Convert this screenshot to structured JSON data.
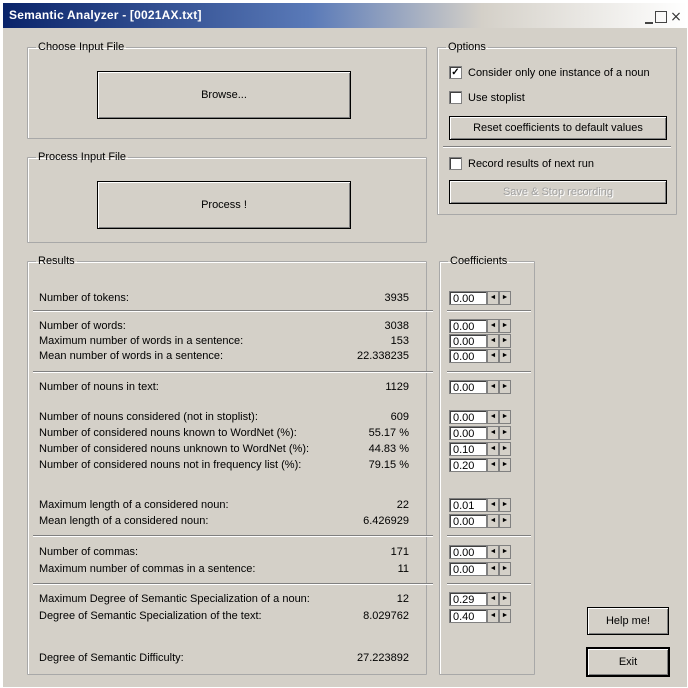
{
  "window": {
    "title": "Semantic Analyzer - [0021AX.txt]",
    "min_glyph": "",
    "max_glyph": "",
    "close_glyph": "×"
  },
  "choose": {
    "legend": "Choose Input File",
    "browse_label": "Browse..."
  },
  "process": {
    "legend": "Process Input File",
    "process_label": "Process !"
  },
  "options": {
    "legend": "Options",
    "one_instance": {
      "label": "Consider only one instance of a noun",
      "checked_glyph": "✓"
    },
    "stoplist": {
      "label": "Use stoplist",
      "checked_glyph": ""
    },
    "reset_label": "Reset coefficients to default values",
    "record": {
      "label": "Record results of next run",
      "checked_glyph": ""
    },
    "save_label": "Save & Stop recording"
  },
  "results": {
    "legend": "Results",
    "rows": [
      {
        "label": "Number of tokens:",
        "value": "3935"
      },
      {
        "label": "Number of words:",
        "value": "3038"
      },
      {
        "label": "Maximum number of words in a sentence:",
        "value": "153"
      },
      {
        "label": "Mean number of words in a sentence:",
        "value": "22.338235"
      },
      {
        "label": "Number of nouns in text:",
        "value": "1129"
      },
      {
        "label": "Number of nouns considered (not in stoplist):",
        "value": "609"
      },
      {
        "label": "Number of considered nouns known to WordNet (%):",
        "value": "55.17 %"
      },
      {
        "label": "Number of considered nouns unknown to WordNet (%):",
        "value": "44.83 %"
      },
      {
        "label": "Number of considered nouns not in frequency list (%):",
        "value": "79.15 %"
      },
      {
        "label": "Maximum length of a considered noun:",
        "value": "22"
      },
      {
        "label": "Mean length of a considered noun:",
        "value": "6.426929"
      },
      {
        "label": "Number of commas:",
        "value": "171"
      },
      {
        "label": "Maximum number of commas in a sentence:",
        "value": "11"
      },
      {
        "label": "Maximum Degree of Semantic Specialization of a noun:",
        "value": "12"
      },
      {
        "label": "Degree of Semantic Specialization of the text:",
        "value": "8.029762"
      },
      {
        "label": "Degree of Semantic Difficulty:",
        "value": "27.223892"
      }
    ]
  },
  "coefficients": {
    "legend": "Coefficients",
    "values": [
      "0.00",
      "0.00",
      "0.00",
      "0.00",
      "0.00",
      "0.00",
      "0.00",
      "0.10",
      "0.20",
      "0.01",
      "0.00",
      "0.00",
      "0.00",
      "0.29",
      "0.40"
    ],
    "spin_left": "◄",
    "spin_right": "►"
  },
  "help_label": "Help me!",
  "exit_label": "Exit"
}
